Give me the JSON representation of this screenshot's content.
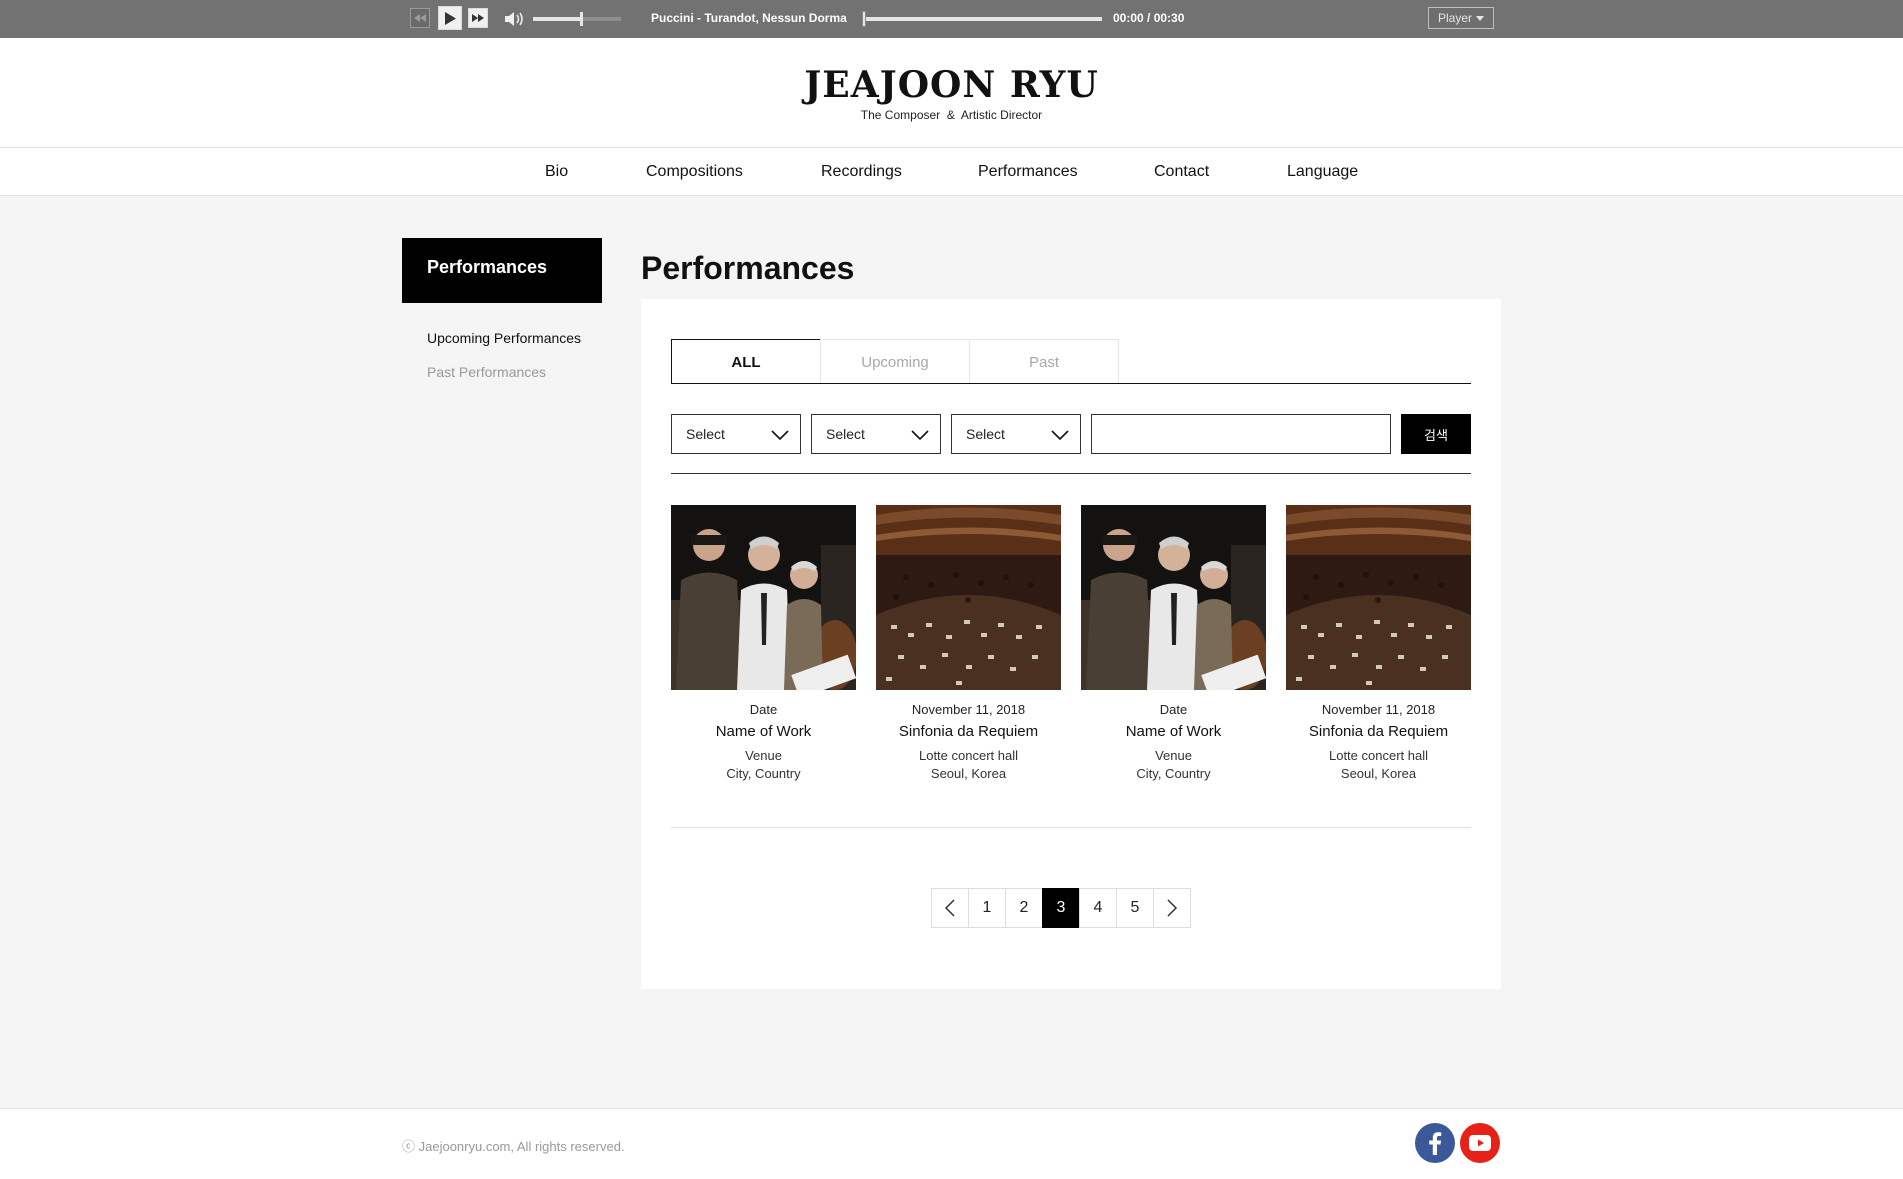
{
  "player": {
    "track_title": "Puccini - Turandot, Nessun Dorma",
    "time": "00:00 / 00:30",
    "volume_level": 0.55,
    "progress": 0.0,
    "menu_label": "Player",
    "icons": [
      "rewind-icon",
      "play-icon",
      "fast-forward-icon",
      "volume-icon",
      "caret-down-icon"
    ]
  },
  "header": {
    "logo_title": "JEAJOON RYU",
    "logo_subtitle": "The Composer  &  Artistic Director"
  },
  "nav": {
    "items": [
      "Bio",
      "Compositions",
      "Recordings",
      "Performances",
      "Contact",
      "Language"
    ]
  },
  "sidebar": {
    "title": "Performances",
    "links": [
      "Upcoming Performances",
      "Past Performances"
    ]
  },
  "main": {
    "title": "Performances",
    "tabs": [
      "ALL",
      "Upcoming",
      "Past"
    ],
    "active_tab": "ALL",
    "filters": [
      "Select",
      "Select",
      "Select"
    ],
    "search_value": "",
    "search_button": "검색",
    "cards": [
      {
        "date": "Date",
        "title": "Name of Work",
        "venue": "Venue",
        "city": "City, Country",
        "image": "trio-photo"
      },
      {
        "date": "November 11, 2018",
        "title": "Sinfonia da Requiem",
        "venue": "Lotte concert hall",
        "city": "Seoul, Korea",
        "image": "orchestra-photo"
      },
      {
        "date": "Date",
        "title": "Name of Work",
        "venue": "Venue",
        "city": "City, Country",
        "image": "trio-photo"
      },
      {
        "date": "November 11, 2018",
        "title": "Sinfonia da Requiem",
        "venue": "Lotte concert hall",
        "city": "Seoul, Korea",
        "image": "orchestra-photo"
      }
    ],
    "pagination": {
      "pages": [
        "1",
        "2",
        "3",
        "4",
        "5"
      ],
      "current": "3"
    }
  },
  "footer": {
    "copyright": "ⓒ Jaejoonryu.com, All rights reserved.",
    "social": [
      "facebook-icon",
      "youtube-icon"
    ],
    "colors": {
      "facebook": "#3b5998",
      "youtube": "#e62117"
    }
  }
}
